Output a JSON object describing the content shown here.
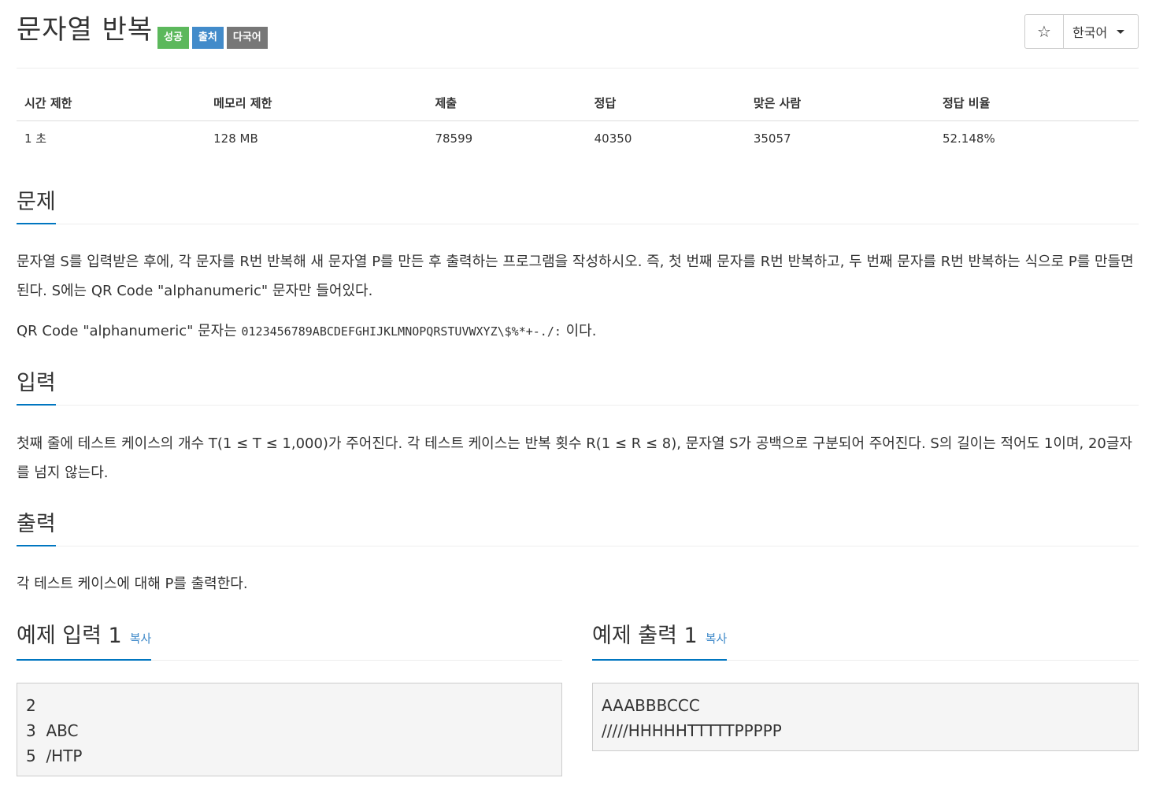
{
  "problem": {
    "title": "문자열 반복",
    "badges": {
      "success": "성공",
      "source": "출처",
      "multilang": "다국어"
    }
  },
  "header_controls": {
    "star_icon": "☆",
    "language": "한국어"
  },
  "stats": {
    "headers": [
      "시간 제한",
      "메모리 제한",
      "제출",
      "정답",
      "맞은 사람",
      "정답 비율"
    ],
    "values": [
      "1 초",
      "128 MB",
      "78599",
      "40350",
      "35057",
      "52.148%"
    ]
  },
  "sections": {
    "problem_heading": "문제",
    "problem_text_1": "문자열 S를 입력받은 후에, 각 문자를 R번 반복해 새 문자열 P를 만든 후 출력하는 프로그램을 작성하시오. 즉, 첫 번째 문자를 R번 반복하고, 두 번째 문자를 R번 반복하는 식으로 P를 만들면 된다. S에는 QR Code \"alphanumeric\" 문자만 들어있다.",
    "problem_text_2_prefix": "QR Code \"alphanumeric\" 문자는 ",
    "problem_text_2_code": "0123456789ABCDEFGHIJKLMNOPQRSTUVWXYZ\\$%*+-./:",
    "problem_text_2_suffix": " 이다.",
    "input_heading": "입력",
    "input_text": "첫째 줄에 테스트 케이스의 개수 T(1 ≤ T ≤ 1,000)가 주어진다. 각 테스트 케이스는 반복 횟수 R(1 ≤ R ≤ 8), 문자열 S가 공백으로 구분되어 주어진다. S의 길이는 적어도 1이며, 20글자를 넘지 않는다.",
    "output_heading": "출력",
    "output_text": "각 테스트 케이스에 대해 P를 출력한다."
  },
  "samples": {
    "input_heading": "예제 입력 1",
    "output_heading": "예제 출력 1",
    "copy_label": "복사",
    "input_text": "2\n3  ABC\n5  /HTP",
    "output_text": "AAABBBCCC\n/////HHHHHTTTTTPPPPP"
  }
}
